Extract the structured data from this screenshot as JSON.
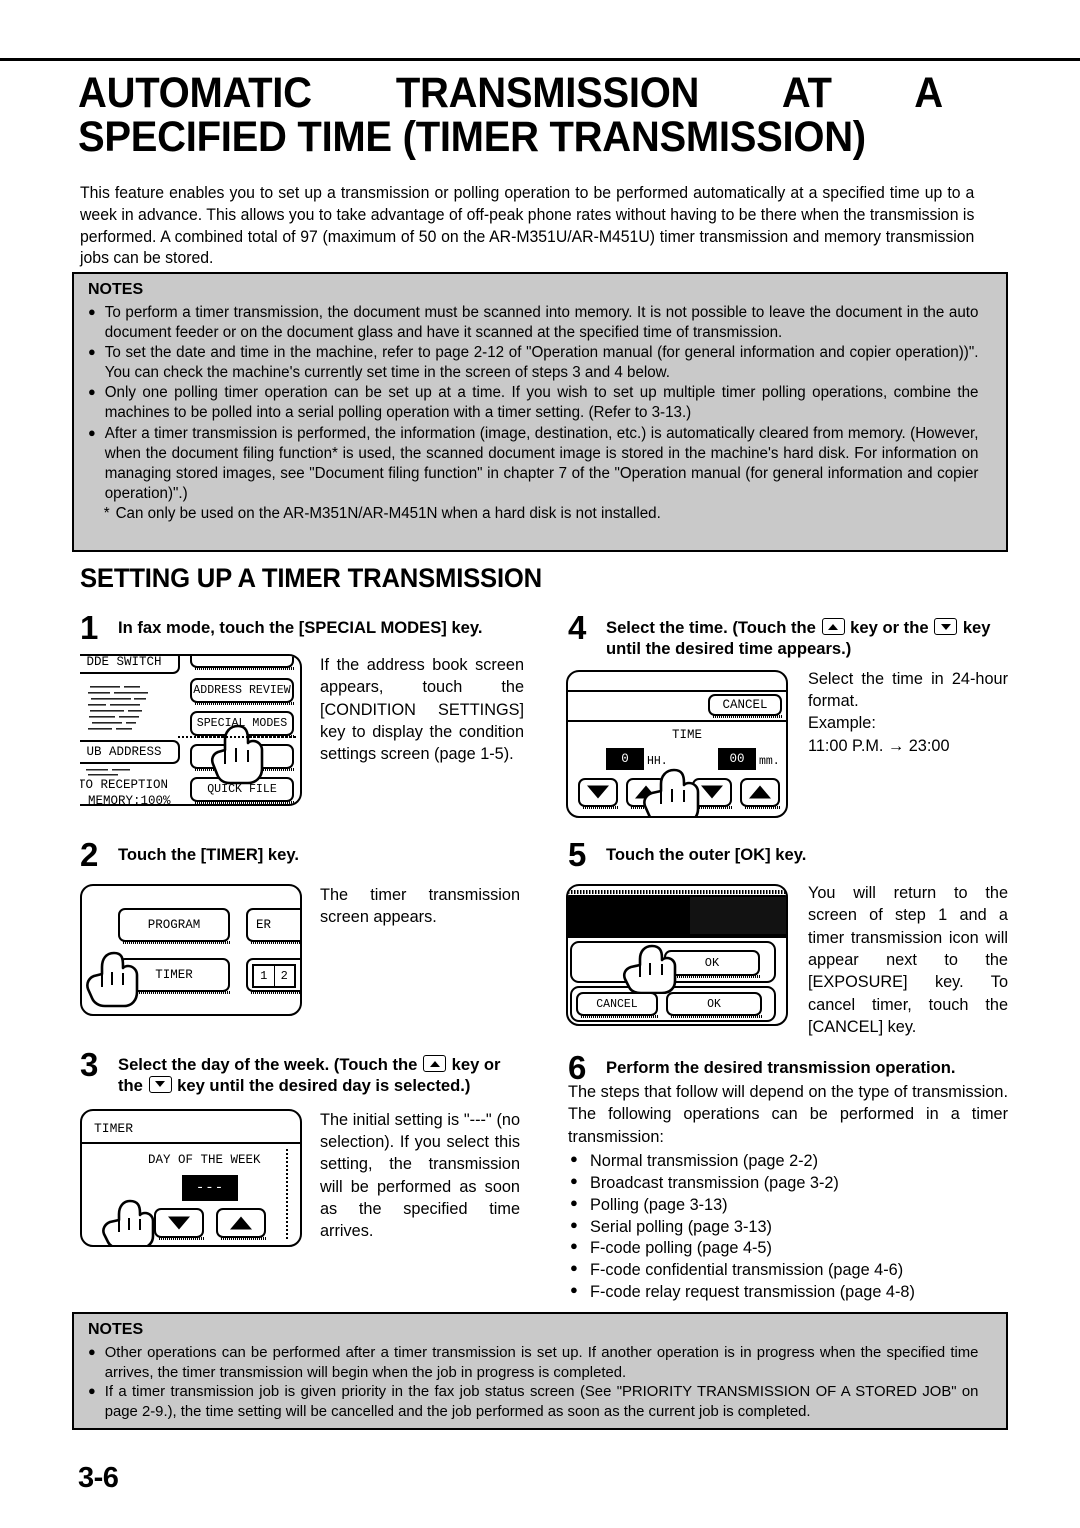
{
  "document": {
    "title_line1": "AUTOMATIC TRANSMISSION AT A",
    "title_line2": "SPECIFIED TIME (TIMER TRANSMISSION)",
    "intro": "This feature enables you to set up a transmission or polling operation to be performed automatically at a specified time up to a week in advance.  This allows you to take advantage of off-peak phone rates without having to be there when the transmission is performed. A combined total of 97 (maximum of 50 on the AR-M351U/AR-M451U) timer transmission and memory transmission jobs can be stored.",
    "section_heading": "SETTING UP A TIMER TRANSMISSION",
    "page_number": "3-6"
  },
  "notes_top": {
    "title": "NOTES",
    "items": [
      "To perform a timer transmission, the document must be scanned into memory. It is not possible to leave the document in the auto document feeder or on the document glass and have it scanned at the specified time of transmission.",
      "To set the date and time in the machine, refer to page 2-12 of \"Operation manual (for general information and copier operation))\". You can check the machine's currently set time in the screen of steps 3 and 4 below.",
      "Only one polling timer operation can be set up at a time. If you wish to set up multiple timer polling operations, combine the machines to be polled into a serial polling operation with a timer setting. (Refer to 3-13.)",
      "After a timer transmission is performed, the information (image, destination, etc.) is automatically cleared from memory. (However, when the document filing function* is used, the scanned document image is stored in the machine's hard disk. For information on managing stored images, see \"Document filing function\" in chapter 7 of the \"Operation manual (for general information and copier operation)\".)"
    ],
    "footnote_marker": "*",
    "footnote": "Can only be used on the AR-M351N/AR-M451N when a hard disk is not installed."
  },
  "notes_bottom": {
    "title": "NOTES",
    "items": [
      "Other operations can be performed after a timer transmission is set up. If another operation is in progress when the specified time arrives, the timer transmission will begin when the job in progress is completed.",
      "If a timer transmission job is given priority in the fax job status screen (See \"PRIORITY TRANSMISSION OF A STORED JOB\" on page 2-9.), the time setting will be cancelled and the job performed as soon as the current job is completed."
    ]
  },
  "steps": {
    "step1": {
      "number": "1",
      "title": "In fax mode, touch the [SPECIAL MODES] key.",
      "text": "If the address book screen appears, touch the [CONDITION SETTINGS] key to display the condition settings screen (page 1-5).",
      "panel": {
        "mode_switch": "DDE SWITCH",
        "sub_address": "UB ADDRESS",
        "auto_reception": "TO RECEPTION",
        "memory": "MEMORY:100%",
        "address_review": "ADDRESS REVIEW",
        "special_modes": "SPECIAL MODES",
        "quick_file": "QUICK FILE"
      }
    },
    "step2": {
      "number": "2",
      "title": "Touch the [TIMER] key.",
      "text": "The timer transmission screen appears.",
      "panel": {
        "program": "PROGRAM",
        "eraser_partial": "ER",
        "timer": "TIMER",
        "page_indicator_left": "1",
        "page_indicator_right": "2"
      }
    },
    "step3": {
      "number": "3",
      "title_part1": "Select the day of the week. (Touch the",
      "title_part2": "key or the",
      "title_part3": "key until the desired day is selected.)",
      "text": "The initial setting is \"---\" (no selection). If you select this setting, the transmission will be performed as soon as the specified time arrives.",
      "panel": {
        "screen_title": "TIMER",
        "day_label": "DAY OF THE WEEK",
        "day_value": "---"
      }
    },
    "step4": {
      "number": "4",
      "title_part1": "Select the time. (Touch the",
      "title_part2": "key or the",
      "title_part3": "key until the desired time appears.)",
      "text_line1": "Select the time in 24-hour format.",
      "text_line2": "Example:",
      "text_line3": "11:00 P.M. → 23:00",
      "panel": {
        "cancel": "CANCEL",
        "time_label": "TIME",
        "hour_value": "0",
        "hour_unit": "HH.",
        "minute_value": "00",
        "minute_unit": "mm."
      }
    },
    "step5": {
      "number": "5",
      "title": "Touch the outer [OK] key.",
      "text": "You will return to the screen of step 1 and a timer transmission icon will appear next to the [EXPOSURE] key. To cancel timer, touch the [CANCEL] key.",
      "panel": {
        "inner_ok": "OK",
        "cancel": "CANCEL",
        "outer_ok": "OK"
      }
    },
    "step6": {
      "number": "6",
      "title": "Perform the desired transmission operation.",
      "text": "The steps that follow will depend on the type of transmission. The following operations can be performed in a timer transmission:",
      "operations": [
        "Normal transmission (page 2-2)",
        "Broadcast transmission (page 3-2)",
        "Polling (page 3-13)",
        "Serial polling (page 3-13)",
        "F-code polling (page 4-5)",
        "F-code confidential transmission (page 4-6)",
        "F-code relay request transmission (page 4-8)"
      ]
    }
  }
}
